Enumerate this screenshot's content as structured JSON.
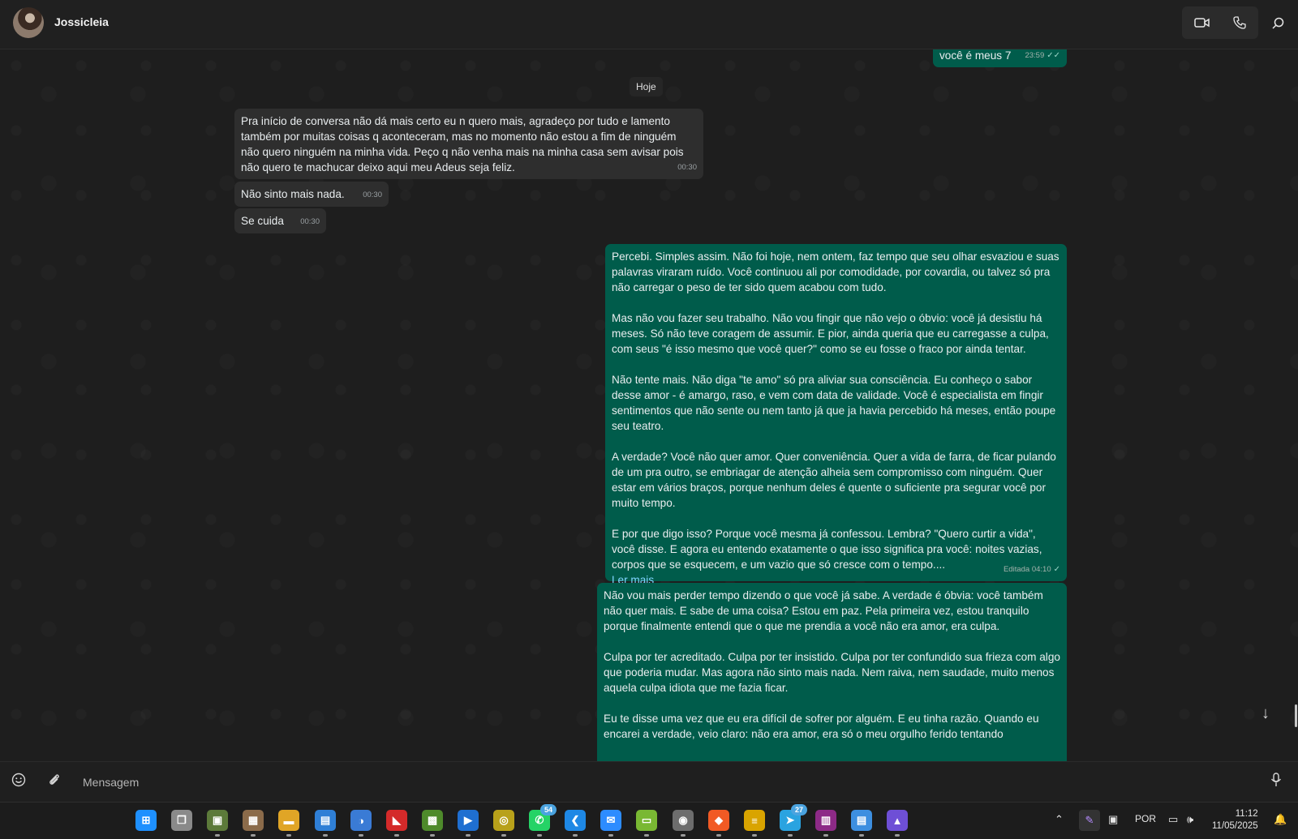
{
  "header": {
    "contact_name": "Jossicleia",
    "icons": [
      "video-call-icon",
      "voice-call-icon",
      "search-icon"
    ]
  },
  "chat": {
    "date_separator": "Hoje",
    "messages": [
      {
        "dir": "out",
        "text": "você é meus 7",
        "time": "23:59",
        "status": "read"
      },
      {
        "dir": "in",
        "text": "Pra início de conversa não dá mais certo eu n quero mais, agradeço por tudo e lamento também por muitas coisas q aconteceram, mas no momento não estou a fim de ninguém não quero ninguém na minha vida. Peço q não venha mais na minha casa sem avisar pois não quero te machucar deixo aqui meu Adeus seja feliz.",
        "time": "00:30"
      },
      {
        "dir": "in",
        "text": "Não sinto mais nada.",
        "time": "00:30"
      },
      {
        "dir": "in",
        "text": "Se cuida",
        "time": "00:30"
      },
      {
        "dir": "out",
        "text": "Percebi. Simples assim. Não foi hoje, nem ontem, faz tempo que seu olhar esvaziou e suas palavras viraram ruído. Você continuou ali por comodidade, por covardia, ou talvez só pra não carregar o peso de ter sido quem acabou com tudo.\n\nMas não vou fazer seu trabalho. Não vou fingir que não vejo o óbvio: você já desistiu há meses. Só não teve coragem de assumir. E pior, ainda queria que eu carregasse a culpa, com seus \"é isso mesmo que você quer?\" como se eu fosse o fraco por ainda tentar.\n\nNão tente mais. Não diga \"te amo\" só pra aliviar sua consciência. Eu conheço o sabor desse amor - é amargo, raso, e vem com data de validade. Você é especialista em fingir sentimentos que não sente ou nem tanto já que ja havia percebido há meses, então poupe seu teatro.\n\nA verdade? Você não quer amor. Quer conveniência. Quer a vida de farra, de ficar pulando de um pra outro, se embriagar de atenção alheia sem compromisso com ninguém. Quer estar em vários braços, porque nenhum deles é quente o suficiente pra segurar você por muito tempo.\n\nE por que digo isso? Porque você mesma já confessou. Lembra? \"Quero curtir a vida\", você disse. E agora eu entendo exatamente o que isso significa pra você: noites vazias, corpos que se esquecem, e um vazio que só cresce com o tempo....",
        "read_more": "Ler mais",
        "time": "Editada 04:10",
        "status": "sent"
      },
      {
        "dir": "out",
        "text": "Não vou mais perder tempo dizendo o que você já sabe. A verdade é óbvia: você também não quer mais. E sabe de uma coisa? Estou em paz. Pela primeira vez, estou tranquilo porque finalmente entendi que o que me prendia a você não era amor, era culpa.\n\nCulpa por ter acreditado. Culpa por ter insistido. Culpa por ter confundido sua frieza com algo que poderia mudar. Mas agora não sinto mais nada. Nem raiva, nem saudade, muito menos aquela culpa idiota que me fazia ficar.\n\nEu te disse uma vez que eu era difícil de sofrer por alguém. E eu tinha razão. Quando eu encarei a verdade, veio claro: não era amor, era só o meu orgulho ferido tentando"
      }
    ]
  },
  "composer": {
    "placeholder": "Mensagem",
    "icons": [
      "emoji-icon",
      "attach-icon",
      "microphone-icon"
    ]
  },
  "taskbar": {
    "apps": [
      {
        "name": "windows-start-icon",
        "color": "#1e90ff",
        "glyph": "⊞"
      },
      {
        "name": "task-view-icon",
        "color": "#8a8a8a",
        "glyph": "❐"
      },
      {
        "name": "minecraft-icon",
        "color": "#5c7a3a",
        "glyph": "▣"
      },
      {
        "name": "pixel-app-icon",
        "color": "#8b6b4a",
        "glyph": "▦"
      },
      {
        "name": "file-explorer-icon",
        "color": "#e0a526",
        "glyph": "▬"
      },
      {
        "name": "microsoft-store-icon",
        "color": "#2f7fd6",
        "glyph": "▤"
      },
      {
        "name": "nintendo-icon",
        "color": "#3a7bd5",
        "glyph": "◑"
      },
      {
        "name": "amd-icon",
        "color": "#d42a2a",
        "glyph": "◣"
      },
      {
        "name": "minecraft-launcher-icon",
        "color": "#4e8a2b",
        "glyph": "▩"
      },
      {
        "name": "remote-app-icon",
        "color": "#1f6fd1",
        "glyph": "▶"
      },
      {
        "name": "headset-app-icon",
        "color": "#b8a11a",
        "glyph": "◎"
      },
      {
        "name": "whatsapp-icon",
        "color": "#25d366",
        "glyph": "✆",
        "badge": "54"
      },
      {
        "name": "vscode-icon",
        "color": "#1e88e5",
        "glyph": "❮"
      },
      {
        "name": "messenger-icon",
        "color": "#2d8cff",
        "glyph": "✉"
      },
      {
        "name": "android-icon",
        "color": "#79b833",
        "glyph": "▭"
      },
      {
        "name": "media-app-icon",
        "color": "#6d6d6d",
        "glyph": "◉"
      },
      {
        "name": "brave-icon",
        "color": "#f15a24",
        "glyph": "◆"
      },
      {
        "name": "stack-app-icon",
        "color": "#d9a400",
        "glyph": "≡"
      },
      {
        "name": "telegram-icon",
        "color": "#2aa3e0",
        "glyph": "➤",
        "badge": "27"
      },
      {
        "name": "winrar-icon",
        "color": "#8d2a87",
        "glyph": "▥"
      },
      {
        "name": "notepad-icon",
        "color": "#3d8fe0",
        "glyph": "▤"
      },
      {
        "name": "photos-icon",
        "color": "#6e4fd6",
        "glyph": "▲"
      }
    ],
    "language": "POR",
    "time": "11:12",
    "date": "11/05/2025"
  }
}
